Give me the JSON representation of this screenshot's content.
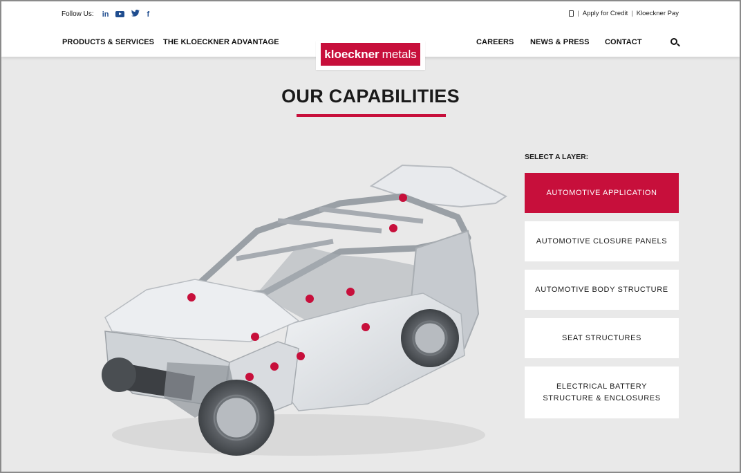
{
  "header": {
    "follow_label": "Follow Us:",
    "social": {
      "linkedin": "in",
      "twitter": "🐦",
      "facebook": "f"
    },
    "utility": {
      "apply_credit": "Apply for Credit",
      "pay": "Kloeckner Pay",
      "separator": "|"
    },
    "nav_left": [
      "PRODUCTS & SERVICES",
      "THE KLOECKNER ADVANTAGE"
    ],
    "nav_right": [
      "CAREERS",
      "NEWS & PRESS",
      "CONTACT"
    ],
    "logo": {
      "bold": "kloeckner",
      "light": "metals"
    }
  },
  "main": {
    "title": "OUR CAPABILITIES",
    "layer_label": "SELECT A LAYER:",
    "layers": [
      {
        "label": "AUTOMOTIVE APPLICATION",
        "active": true
      },
      {
        "label": "AUTOMOTIVE CLOSURE PANELS",
        "active": false
      },
      {
        "label": "AUTOMOTIVE BODY STRUCTURE",
        "active": false
      },
      {
        "label": "SEAT STRUCTURES",
        "active": false
      },
      {
        "label": "ELECTRICAL BATTERY\nSTRUCTURE & ENCLOSURES",
        "active": false
      }
    ],
    "hotspot_count": 11
  },
  "colors": {
    "accent": "#c70f3b",
    "social": "#1f4d8f",
    "background": "#e9e9e9"
  },
  "icons": [
    "linkedin-icon",
    "youtube-icon",
    "twitter-icon",
    "facebook-icon",
    "calculator-icon",
    "search-icon"
  ]
}
